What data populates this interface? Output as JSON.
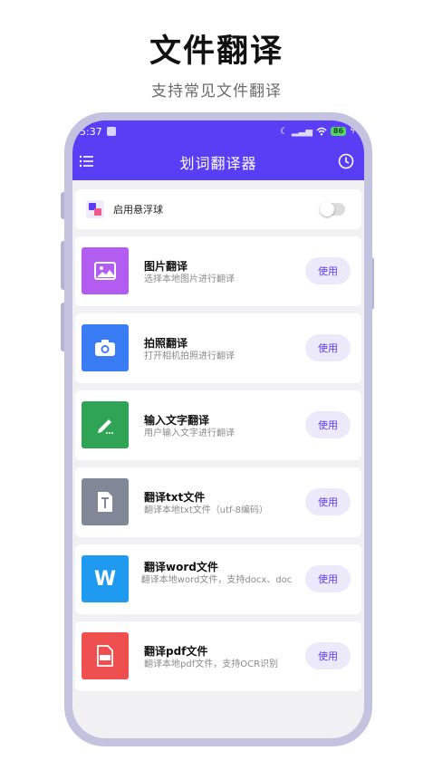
{
  "promo": {
    "title": "文件翻译",
    "subtitle": "支持常见文件翻译"
  },
  "status_bar": {
    "time": "5:37",
    "battery": "86"
  },
  "header": {
    "title": "划词翻译器"
  },
  "float_ball": {
    "label": "启用悬浮球",
    "enabled": false
  },
  "features": [
    {
      "title": "图片翻译",
      "desc": "选择本地图片进行翻译",
      "button": "使用",
      "icon": "image-icon",
      "color": "#b35cf2"
    },
    {
      "title": "拍照翻译",
      "desc": "打开相机拍照进行翻译",
      "button": "使用",
      "icon": "camera-icon",
      "color": "#3a7bf6"
    },
    {
      "title": "输入文字翻译",
      "desc": "用户输入文字进行翻译",
      "button": "使用",
      "icon": "pencil-icon",
      "color": "#2fa454"
    },
    {
      "title": "翻译txt文件",
      "desc": "翻译本地txt文件（utf-8编码）",
      "button": "使用",
      "icon": "txt-file-icon",
      "color": "#808898"
    },
    {
      "title": "翻译word文件",
      "desc": "翻译本地word文件，支持docx、doc",
      "button": "使用",
      "icon": "word-icon",
      "color": "#1e9bf0"
    },
    {
      "title": "翻译pdf文件",
      "desc": "翻译本地pdf文件，支持OCR识别",
      "button": "使用",
      "icon": "pdf-icon",
      "color": "#f04f4f"
    }
  ]
}
